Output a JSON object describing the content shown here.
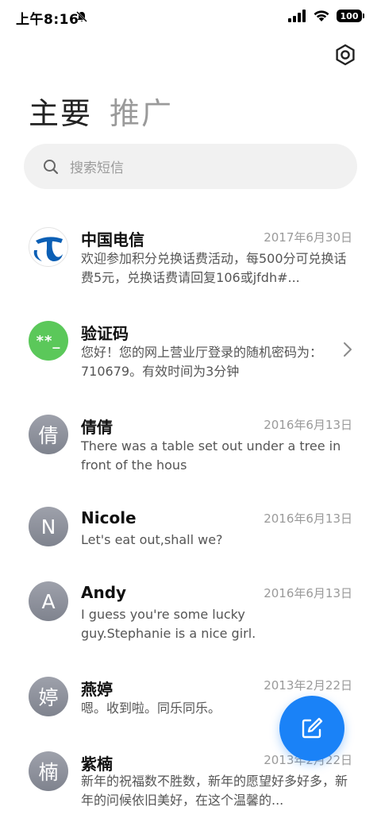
{
  "status_bar": {
    "time": "上午8:16",
    "battery": "100"
  },
  "tabs": [
    {
      "label": "主要",
      "active": true
    },
    {
      "label": "推广",
      "active": false
    }
  ],
  "search": {
    "placeholder": "搜索短信"
  },
  "messages": [
    {
      "name": "中国电信",
      "date": "2017年6月30日",
      "preview": "欢迎参加积分兑换话费活动，每500分可兑换话费5元，兑换话费请回复106或jfdh#...",
      "avatar": {
        "type": "telecom-logo",
        "text": ""
      }
    },
    {
      "name": "验证码",
      "date": "",
      "preview": "您好！您的网上营业厅登录的随机密码为：710679。有效时间为3分钟",
      "avatar": {
        "type": "verification-code",
        "text": "**_"
      }
    },
    {
      "name": "倩倩",
      "date": "2016年6月13日",
      "preview": "There was a table set out under a tree in front of the hous",
      "avatar": {
        "type": "letter",
        "text": "倩"
      }
    },
    {
      "name": "Nicole",
      "date": "2016年6月13日",
      "preview": "Let's eat out,shall we?",
      "avatar": {
        "type": "letter",
        "text": "N"
      }
    },
    {
      "name": "Andy",
      "date": "2016年6月13日",
      "preview": "I guess you're some lucky guy.Stephanie is a nice girl.",
      "avatar": {
        "type": "letter",
        "text": "A"
      }
    },
    {
      "name": "燕婷",
      "date": "2013年2月22日",
      "preview": "嗯。收到啦。同乐同乐。",
      "avatar": {
        "type": "letter",
        "text": "婷"
      }
    },
    {
      "name": "紫楠",
      "date": "2013年2月22日",
      "preview": "新年的祝福数不胜数，新年的愿望好多好多，新年的问候依旧美好，在这个温馨的...",
      "avatar": {
        "type": "letter",
        "text": "楠"
      }
    }
  ],
  "colors": {
    "accent": "#1a82f7",
    "verification_green": "#5bc85a",
    "telecom_blue": "#0b5fb5",
    "avatar_grey": "#8a8d97"
  },
  "icons": {
    "settings": "gear-icon",
    "search": "search-icon",
    "compose": "compose-icon",
    "chevron": "chevron-right-icon"
  }
}
